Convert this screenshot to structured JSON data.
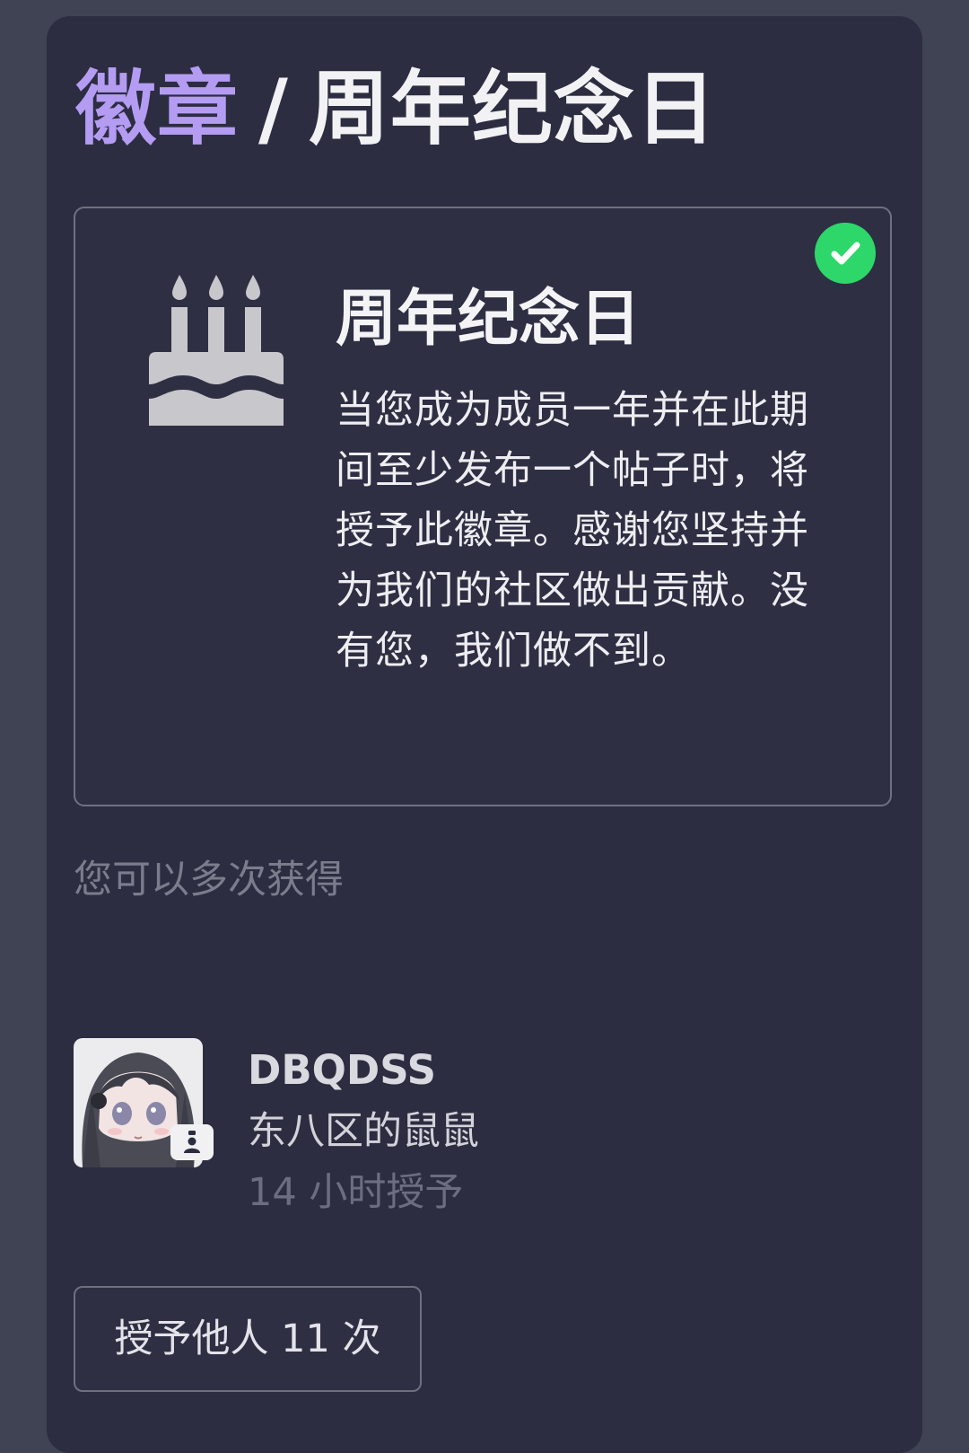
{
  "header": {
    "breadcrumb_link": "徽章",
    "separator": "/",
    "current": "周年纪念日"
  },
  "badge": {
    "name": "周年纪念日",
    "description": "当您成为成员一年并在此期间至少发布一个帖子时，将授予此徽章。感谢您坚持并为我们的社区做出贡献。没有您，我们做不到。",
    "icon": "birthday-cake-icon",
    "earned_icon": "check-circle-icon",
    "earned_color": "#2ed76a"
  },
  "repeat_note": "您可以多次获得",
  "grant": {
    "username": "DBQDSS",
    "user_title": "东八区的鼠鼠",
    "time": "14 小时授予",
    "avatar_badge_icon": "user-card-icon"
  },
  "others_button": {
    "label": "授予他人 11 次"
  },
  "colors": {
    "accent": "#b49cf3",
    "panel": "#2c2d40",
    "background": "#404354"
  }
}
